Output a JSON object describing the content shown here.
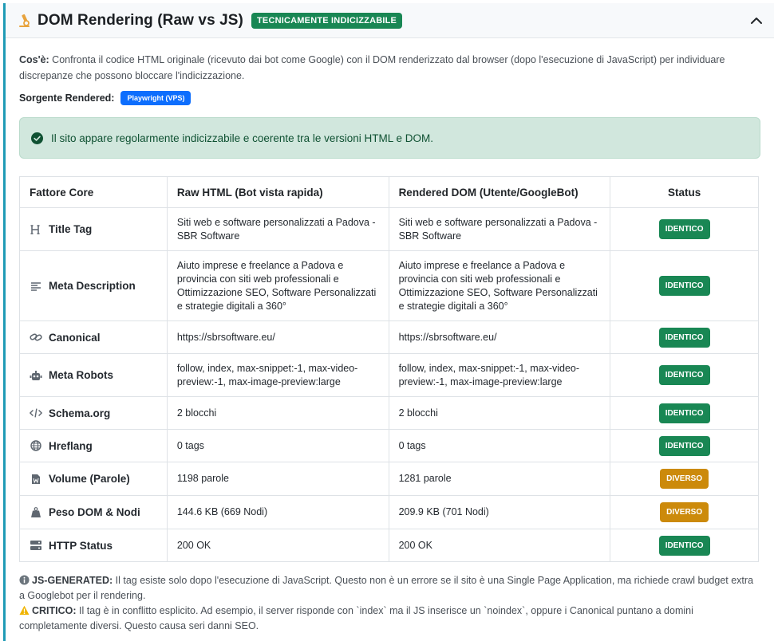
{
  "header": {
    "title": "DOM Rendering (Raw vs JS)",
    "badge": "TECNICAMENTE INDICIZZABILE"
  },
  "intro": {
    "label": "Cos'è:",
    "text": " Confronta il codice HTML originale (ricevuto dai bot come Google) con il DOM renderizzato dal browser (dopo l'esecuzione di JavaScript) per individuare discrepanze che possono bloccare l'indicizzazione."
  },
  "source": {
    "label": "Sorgente Rendered:",
    "badge": "Playwright (VPS)"
  },
  "alert": {
    "text": "Il sito appare regolarmente indicizzabile e coerente tra le versioni HTML e DOM."
  },
  "table": {
    "headers": [
      "Fattore Core",
      "Raw HTML (Bot vista rapida)",
      "Rendered DOM (Utente/GoogleBot)",
      "Status"
    ],
    "rows": [
      {
        "factor": "Title Tag",
        "icon": "heading-icon",
        "raw": "Siti web e software personalizzati a Padova - SBR Software",
        "rendered": "Siti web e software personalizzati a Padova - SBR Software",
        "status": "IDENTICO"
      },
      {
        "factor": "Meta Description",
        "icon": "align-left-icon",
        "raw": "Aiuto imprese e freelance a Padova e provincia con siti web professionali e Ottimizzazione SEO, Software Personalizzati e strategie digitali a 360°",
        "rendered": "Aiuto imprese e freelance a Padova e provincia con siti web professionali e Ottimizzazione SEO, Software Personalizzati e strategie digitali a 360°",
        "status": "IDENTICO"
      },
      {
        "factor": "Canonical",
        "icon": "link-icon",
        "raw": "https://sbrsoftware.eu/",
        "rendered": "https://sbrsoftware.eu/",
        "status": "IDENTICO"
      },
      {
        "factor": "Meta Robots",
        "icon": "robot-icon",
        "raw": "follow, index, max-snippet:-1, max-video-preview:-1, max-image-preview:large",
        "rendered": "follow, index, max-snippet:-1, max-video-preview:-1, max-image-preview:large",
        "status": "IDENTICO"
      },
      {
        "factor": "Schema.org",
        "icon": "code-icon",
        "raw": "2 blocchi",
        "rendered": "2 blocchi",
        "status": "IDENTICO"
      },
      {
        "factor": "Hreflang",
        "icon": "globe-icon",
        "raw": "0 tags",
        "rendered": "0 tags",
        "status": "IDENTICO"
      },
      {
        "factor": "Volume (Parole)",
        "icon": "word-file-icon",
        "raw": "1198 parole",
        "rendered": "1281 parole",
        "status": "DIVERSO"
      },
      {
        "factor": "Peso DOM & Nodi",
        "icon": "weight-icon",
        "raw": "144.6 KB (669 Nodi)",
        "rendered": "209.9 KB (701 Nodi)",
        "status": "DIVERSO"
      },
      {
        "factor": "HTTP Status",
        "icon": "server-icon",
        "raw": "200 OK",
        "rendered": "200 OK",
        "status": "IDENTICO"
      }
    ]
  },
  "notes": {
    "js_label": "JS-GENERATED:",
    "js_text": " Il tag esiste solo dopo l'esecuzione di JavaScript. Questo non è un errore se il sito è una Single Page Application, ma richiede crawl budget extra a Googlebot per il rendering.",
    "crit_label": "CRITICO:",
    "crit_text": " Il tag è in conflitto esplicito. Ad esempio, il server risponde con `index` ma il JS inserisce un `noindex`, oppure i Canonical puntano a domini completamente diversi. Questo causa seri danni SEO."
  },
  "colors": {
    "accent": "#1f9bb6",
    "success": "#198754",
    "warning": "#cc8a0b",
    "primary": "#0d6efd",
    "alert_bg": "#d1e7dd"
  }
}
